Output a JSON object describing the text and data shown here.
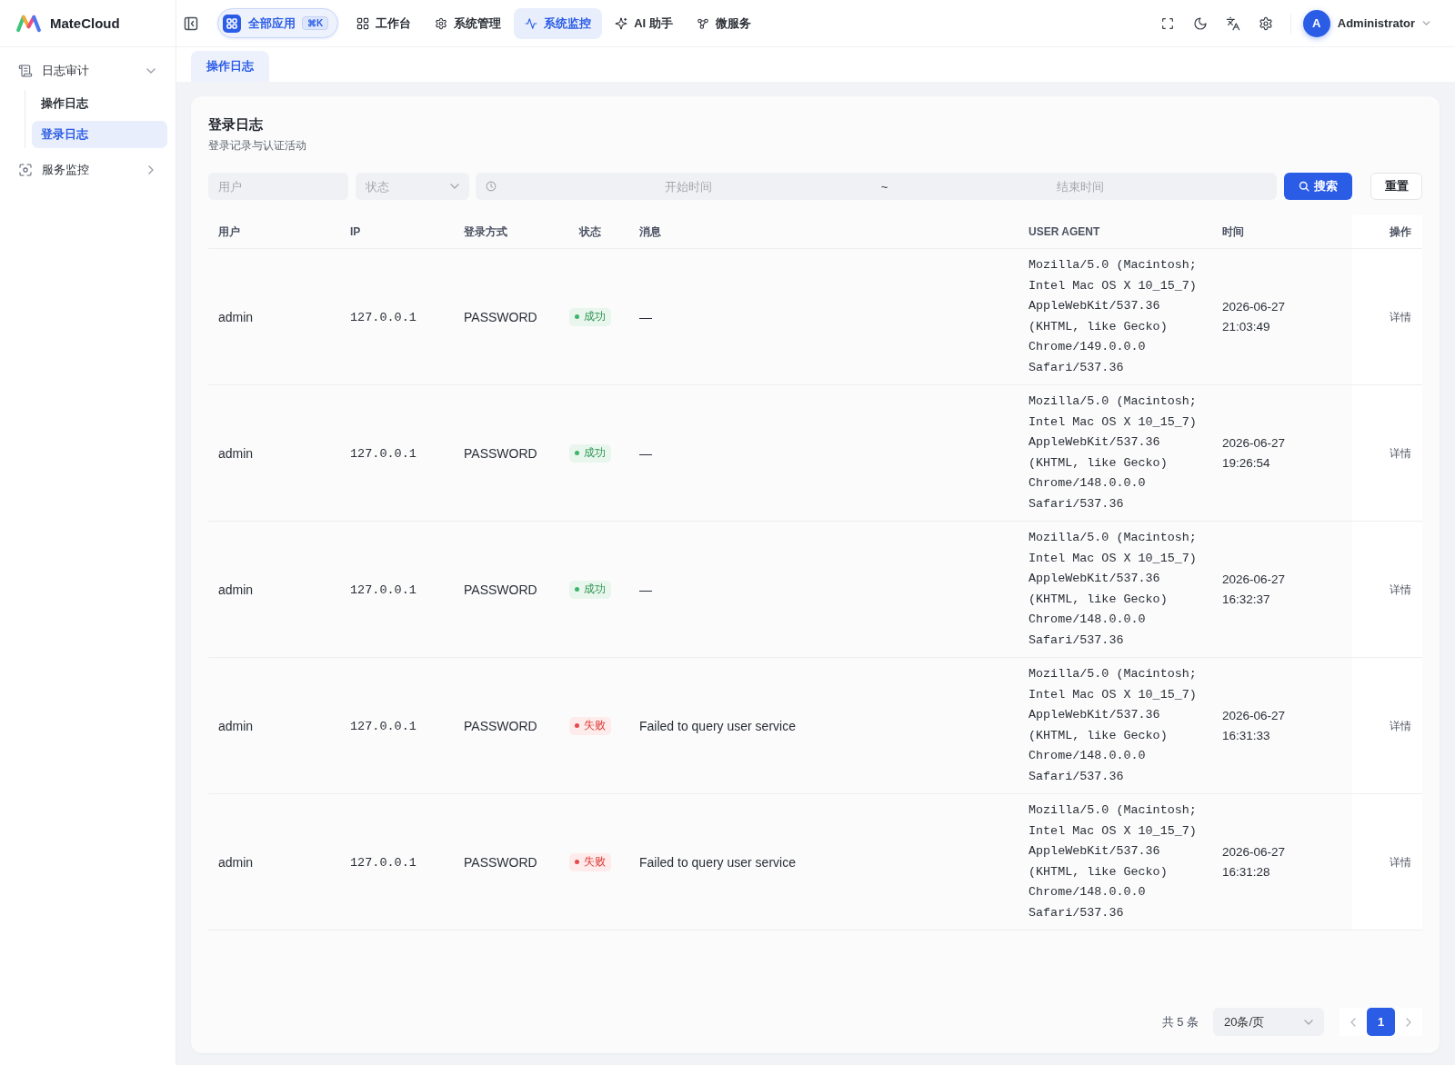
{
  "app": {
    "name": "MateCloud"
  },
  "top_nav": {
    "all_apps": {
      "label": "全部应用",
      "shortcut": "⌘K"
    },
    "items": [
      {
        "label": "工作台",
        "selected": false
      },
      {
        "label": "系统管理",
        "selected": false
      },
      {
        "label": "系统监控",
        "selected": true
      },
      {
        "label": "AI 助手",
        "selected": false
      },
      {
        "label": "微服务",
        "selected": false
      }
    ]
  },
  "user": {
    "avatar": "A",
    "name": "Administrator"
  },
  "sidebar": {
    "items": [
      {
        "label": "日志审计",
        "expanded": true,
        "children": [
          {
            "label": "操作日志",
            "selected": false
          },
          {
            "label": "登录日志",
            "selected": true
          }
        ]
      },
      {
        "label": "服务监控",
        "expanded": false
      }
    ]
  },
  "tabs": [
    {
      "label": "操作日志",
      "selected": true
    }
  ],
  "page": {
    "title": "登录日志",
    "subtitle": "登录记录与认证活动"
  },
  "filters": {
    "user": {
      "placeholder": "用户"
    },
    "status": {
      "placeholder": "状态"
    },
    "date_range": {
      "start": {
        "placeholder": "开始时间"
      },
      "separator": "~",
      "end": {
        "placeholder": "结束时间"
      }
    },
    "search_button": {
      "label": "搜索"
    },
    "reset_button": {
      "label": "重置"
    }
  },
  "table": {
    "columns": [
      "用户",
      "IP",
      "登录方式",
      "状态",
      "消息",
      "USER AGENT",
      "时间",
      "操作"
    ],
    "rows": [
      {
        "user": "admin",
        "ip": "127.0.0.1",
        "method": "PASSWORD",
        "status": {
          "label": "成功",
          "kind": "success"
        },
        "message": "—",
        "user_agent": "Mozilla/5.0 (Macintosh; Intel Mac OS X 10_15_7) AppleWebKit/537.36 (KHTML, like Gecko) Chrome/149.0.0.0 Safari/537.36",
        "time": "2026-06-27 21:03:49",
        "action": "详情"
      },
      {
        "user": "admin",
        "ip": "127.0.0.1",
        "method": "PASSWORD",
        "status": {
          "label": "成功",
          "kind": "success"
        },
        "message": "—",
        "user_agent": "Mozilla/5.0 (Macintosh; Intel Mac OS X 10_15_7) AppleWebKit/537.36 (KHTML, like Gecko) Chrome/148.0.0.0 Safari/537.36",
        "time": "2026-06-27 19:26:54",
        "action": "详情"
      },
      {
        "user": "admin",
        "ip": "127.0.0.1",
        "method": "PASSWORD",
        "status": {
          "label": "成功",
          "kind": "success"
        },
        "message": "—",
        "user_agent": "Mozilla/5.0 (Macintosh; Intel Mac OS X 10_15_7) AppleWebKit/537.36 (KHTML, like Gecko) Chrome/148.0.0.0 Safari/537.36",
        "time": "2026-06-27 16:32:37",
        "action": "详情"
      },
      {
        "user": "admin",
        "ip": "127.0.0.1",
        "method": "PASSWORD",
        "status": {
          "label": "失败",
          "kind": "failure"
        },
        "message": "Failed to query user service",
        "user_agent": "Mozilla/5.0 (Macintosh; Intel Mac OS X 10_15_7) AppleWebKit/537.36 (KHTML, like Gecko) Chrome/148.0.0.0 Safari/537.36",
        "time": "2026-06-27 16:31:33",
        "action": "详情"
      },
      {
        "user": "admin",
        "ip": "127.0.0.1",
        "method": "PASSWORD",
        "status": {
          "label": "失败",
          "kind": "failure"
        },
        "message": "Failed to query user service",
        "user_agent": "Mozilla/5.0 (Macintosh; Intel Mac OS X 10_15_7) AppleWebKit/537.36 (KHTML, like Gecko) Chrome/148.0.0.0 Safari/537.36",
        "time": "2026-06-27 16:31:28",
        "action": "详情"
      }
    ]
  },
  "pagination": {
    "total": "共 5 条",
    "page_size": "20条/页",
    "pages": [
      {
        "label": "1",
        "selected": true
      }
    ]
  }
}
